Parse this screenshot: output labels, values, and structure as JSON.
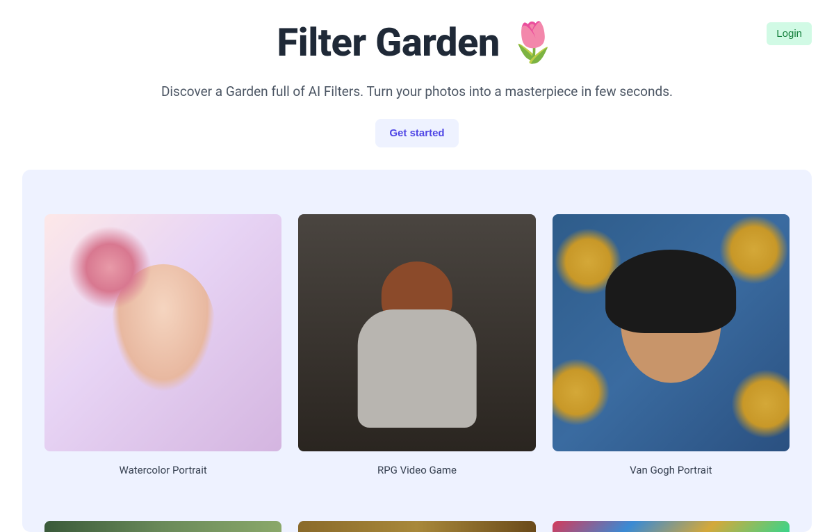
{
  "header": {
    "login_label": "Login"
  },
  "hero": {
    "title": "Filter Garden 🌷",
    "subtitle": "Discover a Garden full of AI Filters. Turn your photos into a masterpiece in few seconds.",
    "cta_label": "Get started"
  },
  "gallery": {
    "filters": [
      {
        "label": "Watercolor Portrait"
      },
      {
        "label": "RPG Video Game"
      },
      {
        "label": "Van Gogh Portrait"
      }
    ]
  }
}
